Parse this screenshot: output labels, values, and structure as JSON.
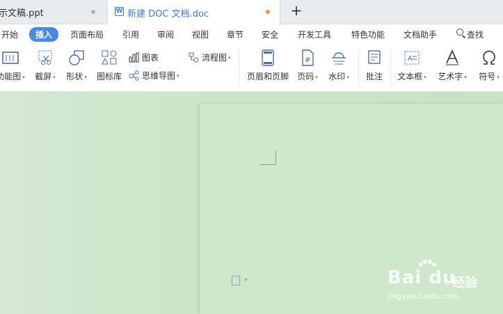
{
  "tabs": [
    {
      "label": "示文稿.ppt"
    },
    {
      "label": "新建 DOC 文档.doc"
    }
  ],
  "menu": {
    "items": [
      "开始",
      "插入",
      "页面布局",
      "引用",
      "审阅",
      "视图",
      "章节",
      "安全",
      "开发工具",
      "特色功能",
      "文档助手"
    ],
    "search": "查找",
    "active": "插入"
  },
  "ribbon": {
    "func_chart": "功能图",
    "screenshot": "截屏",
    "shapes": "形状",
    "icon_lib": "图标库",
    "chart": "图表",
    "mindmap": "思维导图",
    "flowchart": "流程图",
    "header_footer": "页眉和页脚",
    "page_number": "页码",
    "watermark": "水印",
    "comment": "批注",
    "textbox": "文本框",
    "wordart": "艺术字",
    "symbol": "符号"
  },
  "watermark": {
    "brand": "Bai du",
    "jingyan": "经验",
    "url": "jingyan.baidu.com"
  },
  "colors": {
    "accent": "#4a88e6",
    "unsaved_dot": "#f0953a",
    "doc_bg": "#cfe8cc"
  }
}
